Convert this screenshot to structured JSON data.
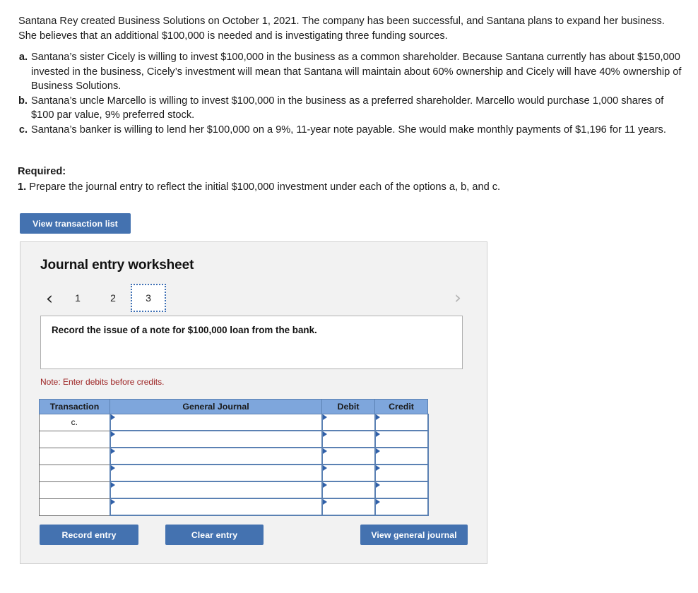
{
  "intro": {
    "paragraph": "Santana Rey created Business Solutions on October 1, 2021. The company has been successful, and Santana plans to expand her business. She believes that an additional $100,000 is needed and is investigating three funding sources."
  },
  "options": [
    {
      "letter": "a.",
      "text": "Santana’s sister Cicely is willing to invest $100,000 in the business as a common shareholder. Because Santana currently has about $150,000 invested in the business, Cicely’s investment will mean that Santana will maintain about 60% ownership and Cicely will have 40% ownership of Business Solutions."
    },
    {
      "letter": "b.",
      "text": "Santana’s uncle Marcello is willing to invest $100,000 in the business as a preferred shareholder. Marcello would purchase 1,000 shares of $100 par value, 9% preferred stock."
    },
    {
      "letter": "c.",
      "text": "Santana’s banker is willing to lend her $100,000 on a 9%, 11-year note payable. She would make monthly payments of $1,196 for 11 years."
    }
  ],
  "required": {
    "title": "Required:",
    "number": "1.",
    "text": "Prepare the journal entry to reflect the initial $100,000 investment under each of the options a, b, and c."
  },
  "buttons": {
    "view_transaction_list": "View transaction list",
    "record_entry": "Record entry",
    "clear_entry": "Clear entry",
    "view_general_journal": "View general journal"
  },
  "worksheet": {
    "title": "Journal entry worksheet",
    "pager": {
      "prev_icon": "chevron-left-icon",
      "next_icon": "chevron-right-icon",
      "prev_glyph": "‹",
      "next_glyph": "›",
      "tabs": [
        "1",
        "2",
        "3"
      ],
      "active_tab": "3"
    },
    "prompt": "Record the issue of a note for $100,000 loan from the bank.",
    "note": "Note: Enter debits before credits.",
    "table": {
      "headers": [
        "Transaction",
        "General Journal",
        "Debit",
        "Credit"
      ],
      "rows": [
        {
          "transaction": "c.",
          "general_journal": "",
          "debit": "",
          "credit": ""
        },
        {
          "transaction": "",
          "general_journal": "",
          "debit": "",
          "credit": ""
        },
        {
          "transaction": "",
          "general_journal": "",
          "debit": "",
          "credit": ""
        },
        {
          "transaction": "",
          "general_journal": "",
          "debit": "",
          "credit": ""
        },
        {
          "transaction": "",
          "general_journal": "",
          "debit": "",
          "credit": ""
        },
        {
          "transaction": "",
          "general_journal": "",
          "debit": "",
          "credit": ""
        }
      ]
    }
  },
  "colors": {
    "accent_blue": "#4472b0",
    "table_header_blue": "#7ea6dc",
    "cell_border_blue": "#5b81b3",
    "note_red": "#9c2222",
    "panel_bg": "#f2f2f2"
  }
}
